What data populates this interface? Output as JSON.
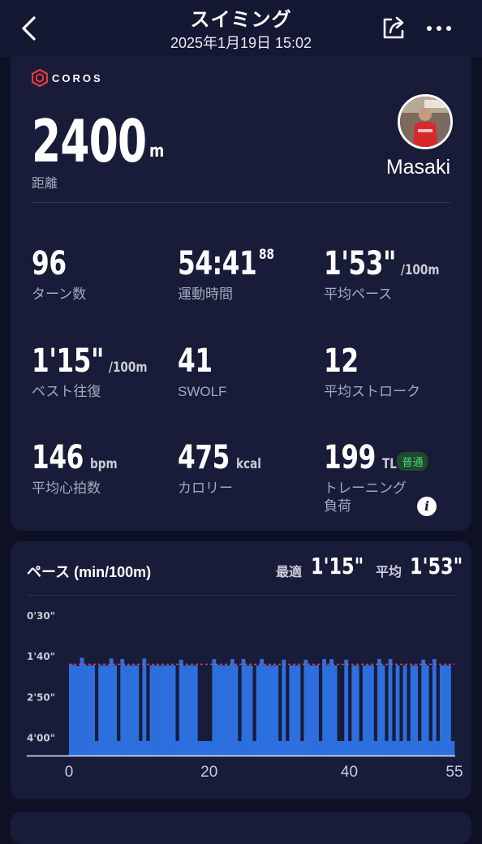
{
  "header": {
    "title": "スイミング",
    "datetime": "2025年1月19日 15:02",
    "back_icon": "chevron-left-icon",
    "share_icon": "share-icon",
    "more_icon": "more-dots-icon"
  },
  "summary": {
    "brand": "COROS",
    "distance_value": "2400",
    "distance_unit": "m",
    "distance_label": "距離",
    "user_name": "Masaki"
  },
  "stats": [
    {
      "value": "96",
      "unit": "",
      "sup": "",
      "label": "ターン数"
    },
    {
      "value": "54:41",
      "unit": "",
      "sup": "88",
      "label": "運動時間"
    },
    {
      "value": "1'53\"",
      "unit": "/100m",
      "sup": "",
      "label": "平均ペース"
    },
    {
      "value": "1'15\"",
      "unit": "/100m",
      "sup": "",
      "label": "ベスト往復"
    },
    {
      "value": "41",
      "unit": "",
      "sup": "",
      "label": "SWOLF"
    },
    {
      "value": "12",
      "unit": "",
      "sup": "",
      "label": "平均ストローク"
    },
    {
      "value": "146",
      "unit": "bpm",
      "sup": "",
      "label": "平均心拍数"
    },
    {
      "value": "475",
      "unit": "kcal",
      "sup": "",
      "label": "カロリー"
    },
    {
      "value": "199",
      "unit": "TL",
      "sup": "",
      "label": "トレーニング\n負荷",
      "badge": "普通"
    }
  ],
  "pace_chart": {
    "title": "ペース (min/100m)",
    "best_label": "最適",
    "best_value": "1'15\"",
    "avg_label": "平均",
    "avg_value": "1'53\""
  },
  "colors": {
    "background": "#0e1124",
    "card": "#181c38",
    "bar": "#2d6fde",
    "avg_line": "#e0485c",
    "badge_text": "#4fd27a"
  },
  "chart_data": {
    "type": "bar",
    "title": "ペース (min/100m)",
    "xlabel": "",
    "ylabel": "",
    "y_tick_labels": [
      "0'30\"",
      "1'40\"",
      "2'50\"",
      "4'00\""
    ],
    "y_ticks_seconds": [
      30,
      100,
      170,
      240
    ],
    "ylim_seconds": [
      30,
      270
    ],
    "y_inverted": true,
    "x_ticks": [
      0,
      20,
      40,
      55
    ],
    "xlim": [
      0,
      55
    ],
    "avg_line_seconds": 113,
    "series": [
      {
        "values_seconds": [
          113,
          115,
          116,
          102,
          115,
          115,
          115,
          245,
          115,
          115,
          115,
          103,
          115,
          245,
          104,
          115,
          115,
          115,
          115,
          245,
          103,
          245,
          115,
          115,
          115,
          115,
          115,
          115,
          115,
          245,
          105,
          115,
          115,
          115,
          115,
          245,
          245,
          245,
          245,
          104,
          114,
          115,
          115,
          115,
          104,
          115,
          245,
          104,
          115,
          115,
          245,
          115,
          104,
          115,
          115,
          115,
          115,
          245,
          105,
          245,
          115,
          115,
          115,
          245,
          105,
          115,
          115,
          115,
          245,
          104,
          115,
          104,
          115,
          245,
          245,
          105,
          245,
          115,
          115,
          245,
          115,
          115,
          115,
          245,
          104,
          115,
          245,
          104,
          245,
          115,
          245,
          115,
          245,
          115,
          115,
          245,
          105,
          115,
          245,
          104,
          245,
          115,
          115,
          115,
          245
        ]
      }
    ]
  }
}
